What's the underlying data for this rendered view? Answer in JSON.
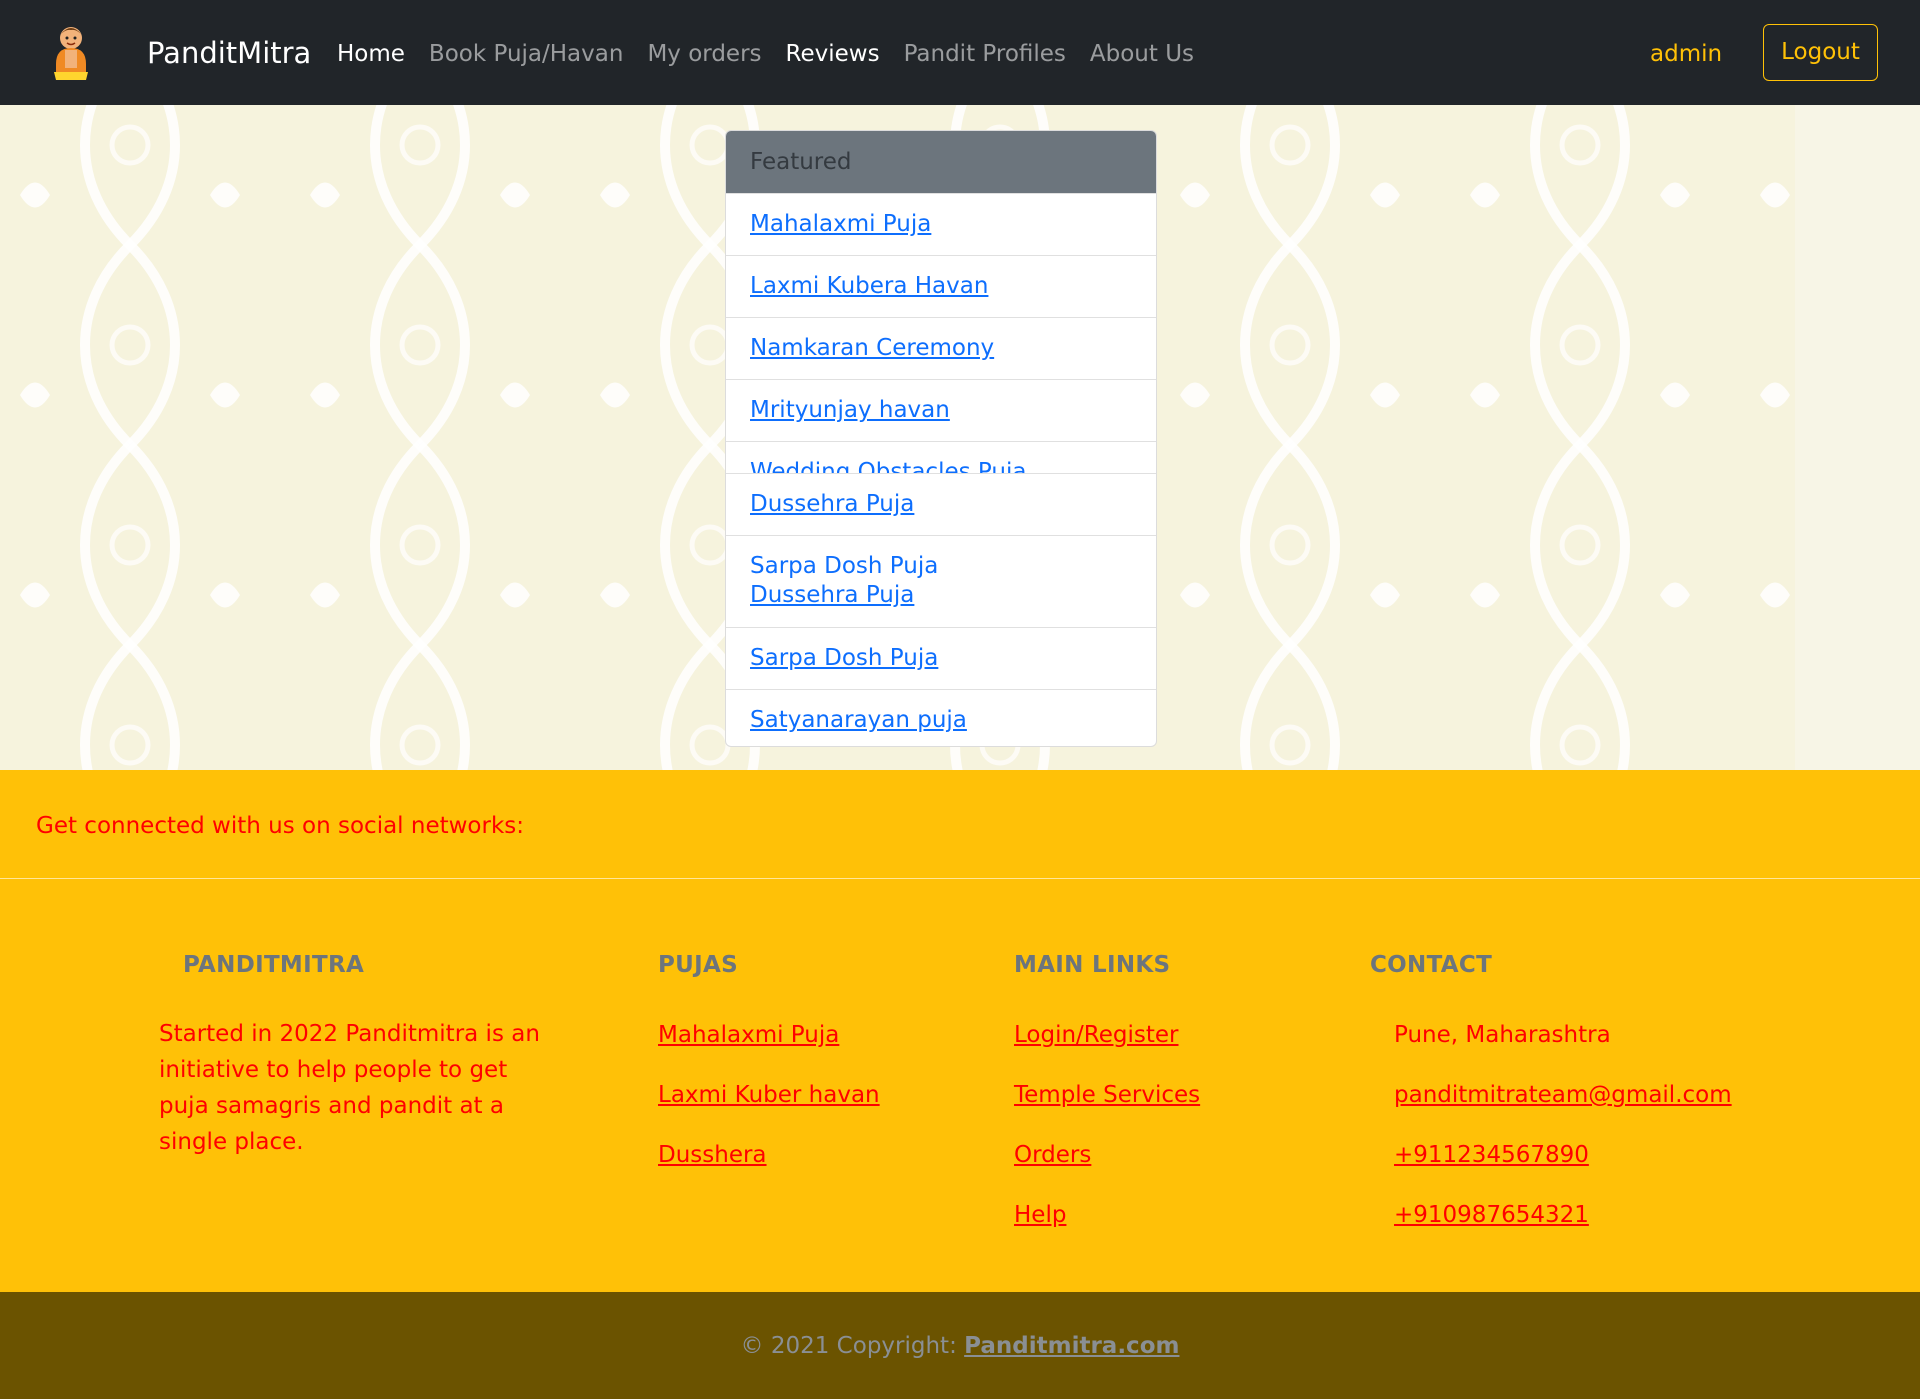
{
  "navbar": {
    "brand": "PanditMitra",
    "links": [
      {
        "label": "Home",
        "active": true
      },
      {
        "label": "Book Puja/Havan",
        "active": false
      },
      {
        "label": "My orders",
        "active": false
      },
      {
        "label": "Reviews",
        "active": true
      },
      {
        "label": "Pandit Profiles",
        "active": false
      },
      {
        "label": "About Us",
        "active": false
      }
    ],
    "user": "admin",
    "logout_label": "Logout"
  },
  "featured": {
    "header": "Featured",
    "items": [
      "Mahalaxmi Puja",
      "Laxmi Kubera Havan",
      "Namkaran Ceremony",
      "Mrityunjay havan",
      "Wedding Obstacles Puja",
      "Dussehra Puja",
      "Sarpa Dosh Puja",
      "Dussehra Puja",
      "Sarpa Dosh Puja",
      "Satyanarayan puja"
    ]
  },
  "footer": {
    "social_text": "Get connected with us on social networks:",
    "about": {
      "title": "PANDITMITRA",
      "text": "Started in 2022 Panditmitra is an initiative to help people to get puja samagris and pandit at a single place."
    },
    "pujas": {
      "title": "PUJAS",
      "links": [
        "Mahalaxmi Puja",
        "Laxmi Kuber havan",
        "Dusshera"
      ]
    },
    "main_links": {
      "title": "MAIN LINKS",
      "links": [
        "Login/Register",
        "Temple Services",
        "Orders",
        "Help"
      ]
    },
    "contact": {
      "title": "CONTACT",
      "address": "Pune, Maharashtra",
      "email": "panditmitrateam@gmail.com",
      "phone1": "+911234567890",
      "phone2": "+910987654321"
    }
  },
  "copyright": {
    "text": "© 2021 Copyright: ",
    "link": "Panditmitra.com"
  },
  "colors": {
    "navbar_bg": "#212529",
    "accent_yellow": "#ffc107",
    "footer_text_red": "#ff0000",
    "copyright_bg": "#6b5300",
    "link_blue": "#0d6efd"
  }
}
